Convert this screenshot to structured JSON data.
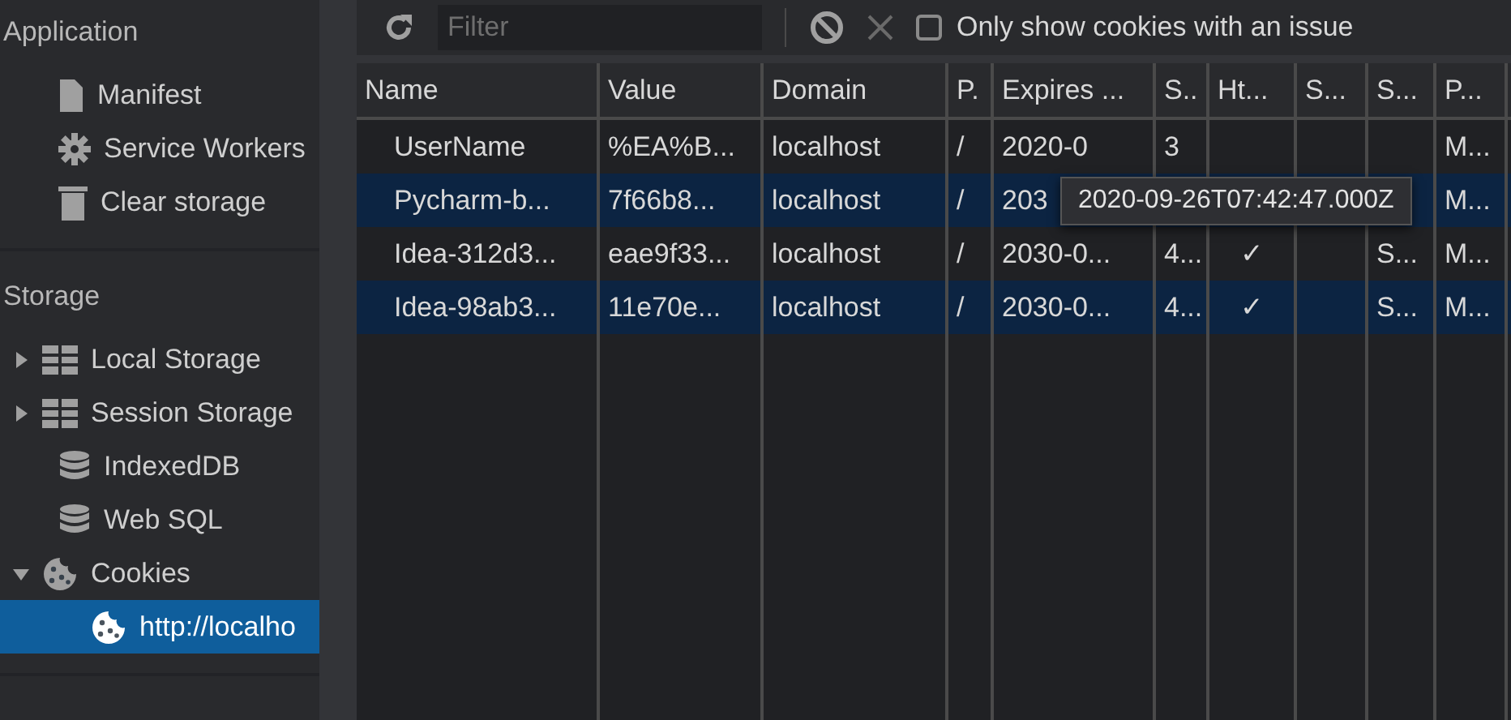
{
  "sidebar": {
    "sections": [
      {
        "title": "Application",
        "items": [
          {
            "label": "Manifest",
            "selected": false
          },
          {
            "label": "Service Workers",
            "selected": false
          },
          {
            "label": "Clear storage",
            "selected": false
          }
        ]
      },
      {
        "title": "Storage",
        "items": [
          {
            "label": "Local Storage",
            "expanded": false,
            "selected": false
          },
          {
            "label": "Session Storage",
            "expanded": false,
            "selected": false
          },
          {
            "label": "IndexedDB",
            "selected": false
          },
          {
            "label": "Web SQL",
            "selected": false
          },
          {
            "label": "Cookies",
            "expanded": true,
            "selected": false,
            "children": [
              {
                "label": "http://localho",
                "selected": true
              }
            ]
          }
        ]
      }
    ]
  },
  "toolbar": {
    "filter": {
      "placeholder": "Filter"
    },
    "checkbox": {
      "label": "Only show cookies with an issue",
      "checked": false
    }
  },
  "table": {
    "columns": [
      "Name",
      "Value",
      "Domain",
      "P.",
      "Expires ...",
      "S..",
      "Ht...",
      "S...",
      "S...",
      "P..."
    ],
    "rows": [
      {
        "cells": [
          "UserName",
          "%EA%B...",
          "localhost",
          "/",
          "2020-0",
          "3",
          "",
          "",
          "",
          "M..."
        ],
        "selected": false
      },
      {
        "cells": [
          "Pycharm-b...",
          "7f66b8...",
          "localhost",
          "/",
          "203",
          "",
          "",
          "",
          "",
          "M..."
        ],
        "selected": true
      },
      {
        "cells": [
          "Idea-312d3...",
          "eae9f33...",
          "localhost",
          "/",
          "2030-0...",
          "4...",
          "✓",
          "",
          "S...",
          "M..."
        ],
        "selected": false
      },
      {
        "cells": [
          "Idea-98ab3...",
          "11e70e...",
          "localhost",
          "/",
          "2030-0...",
          "4...",
          "✓",
          "",
          "S...",
          "M..."
        ],
        "selected": true
      }
    ]
  },
  "tooltip": {
    "text": "2020-09-26T07:42:47.000Z"
  }
}
